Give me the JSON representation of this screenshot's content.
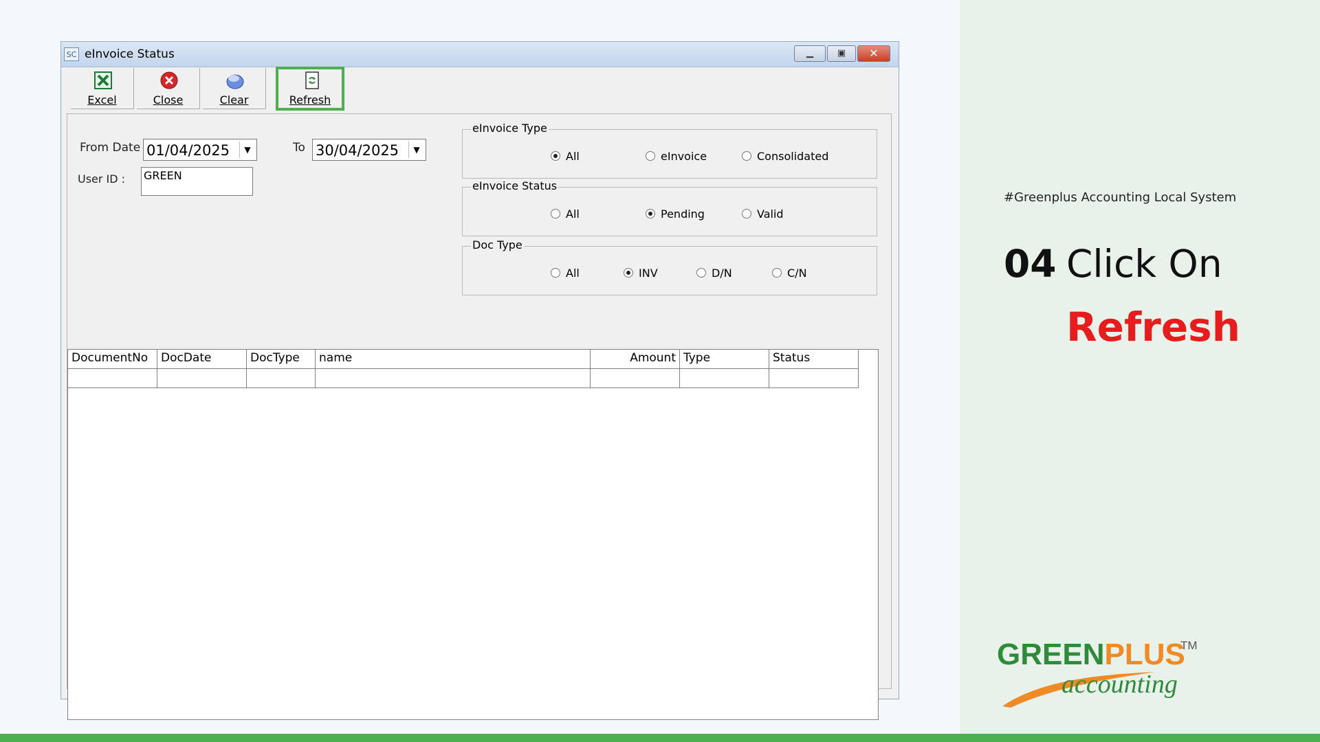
{
  "window": {
    "icon_text": "SC",
    "title": "eInvoice Status",
    "min_glyph": "▁",
    "max_glyph": "▣",
    "close_glyph": "✕"
  },
  "toolbar": {
    "excel_label": "Excel",
    "close_label": "Close",
    "clear_label": "Clear",
    "refresh_label": "Refresh"
  },
  "filters": {
    "from_date_label": "From Date",
    "from_date_value": "01/04/2025",
    "to_label": "To",
    "to_date_value": "30/04/2025",
    "user_id_label": "User ID :",
    "user_id_value": "GREEN",
    "dropdown_glyph": "▼"
  },
  "einvoice_type": {
    "title": "eInvoice Type",
    "options": [
      "All",
      "eInvoice",
      "Consolidated"
    ],
    "selected": "All"
  },
  "einvoice_status": {
    "title": "eInvoice Status",
    "options": [
      "All",
      "Pending",
      "Valid"
    ],
    "selected": "Pending"
  },
  "doc_type": {
    "title": "Doc Type",
    "options": [
      "All",
      "INV",
      "D/N",
      "C/N"
    ],
    "selected": "INV"
  },
  "grid": {
    "columns": [
      "DocumentNo",
      "DocDate",
      "DocType",
      "name",
      "Amount",
      "Type",
      "Status"
    ]
  },
  "side": {
    "hashtag": "#Greenplus Accounting Local System",
    "step_number": "04",
    "step_text": "Click On",
    "step_action": "Refresh"
  },
  "logo": {
    "green_part": "GREEN",
    "plus_part": "PLUS",
    "tm": "TM",
    "sub": "accounting"
  },
  "colors": {
    "accent_green": "#4caf50",
    "action_red": "#e81c1c",
    "logo_green": "#2e8b3a",
    "logo_orange": "#f08a24"
  }
}
